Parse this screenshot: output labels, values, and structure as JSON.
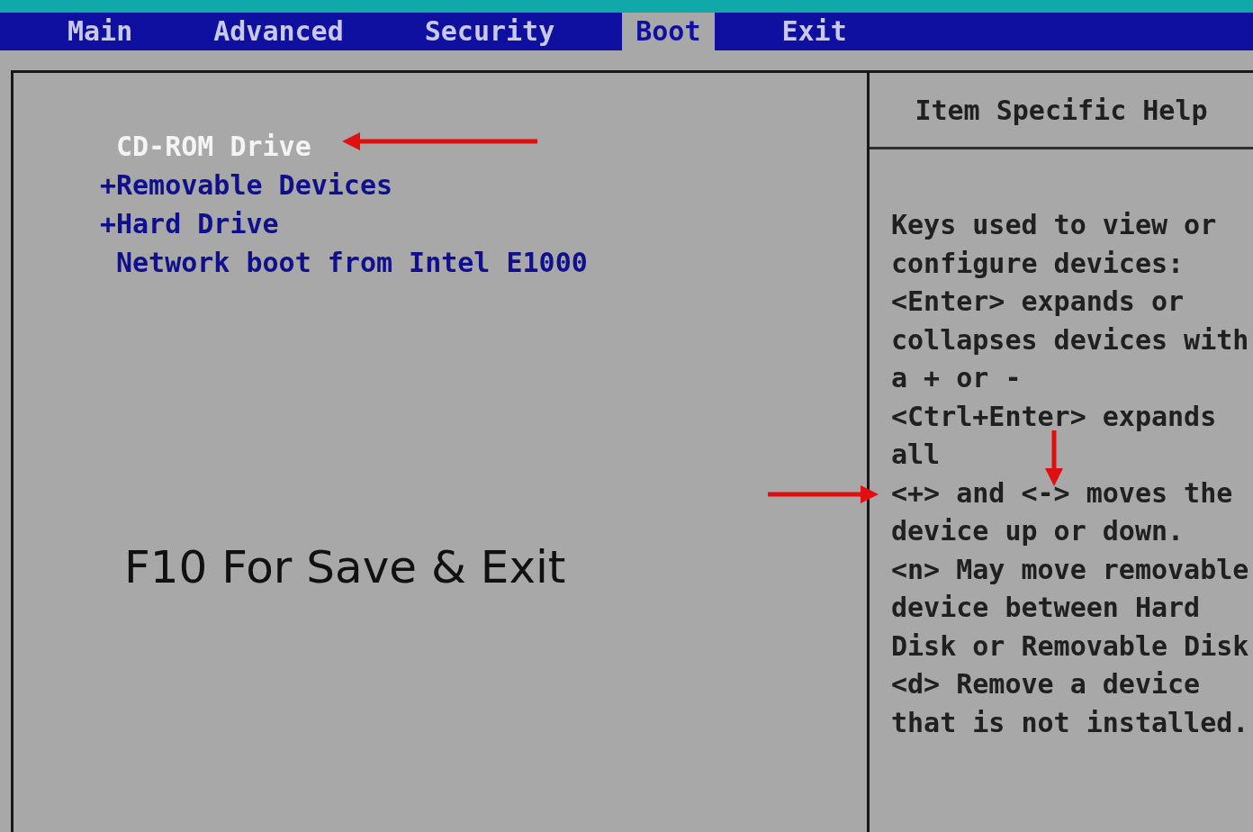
{
  "menu": [
    {
      "label": "Main",
      "selected": false
    },
    {
      "label": "Advanced",
      "selected": false
    },
    {
      "label": "Security",
      "selected": false
    },
    {
      "label": "Boot",
      "selected": true
    },
    {
      "label": "Exit",
      "selected": false
    }
  ],
  "boot_order": [
    {
      "label": "CD-ROM Drive",
      "selected": true
    },
    {
      "prefix": "+",
      "label": "Removable Devices",
      "selected": false
    },
    {
      "prefix": "+",
      "label": "Hard Drive",
      "selected": false
    },
    {
      "label": "Network boot from Intel E1000",
      "selected": false
    }
  ],
  "overlay_caption": "F10 For Save & Exit",
  "help": {
    "title": "Item Specific Help",
    "lines": [
      "Keys used to view or",
      "configure devices:",
      "<Enter> expands or",
      "collapses devices with",
      "a + or -",
      "<Ctrl+Enter> expands",
      "all",
      "<+> and <-> moves the",
      "device up or down.",
      "<n> May move removable",
      "device between Hard",
      "Disk or Removable Disk",
      "<d> Remove a device",
      "that is not installed."
    ]
  }
}
